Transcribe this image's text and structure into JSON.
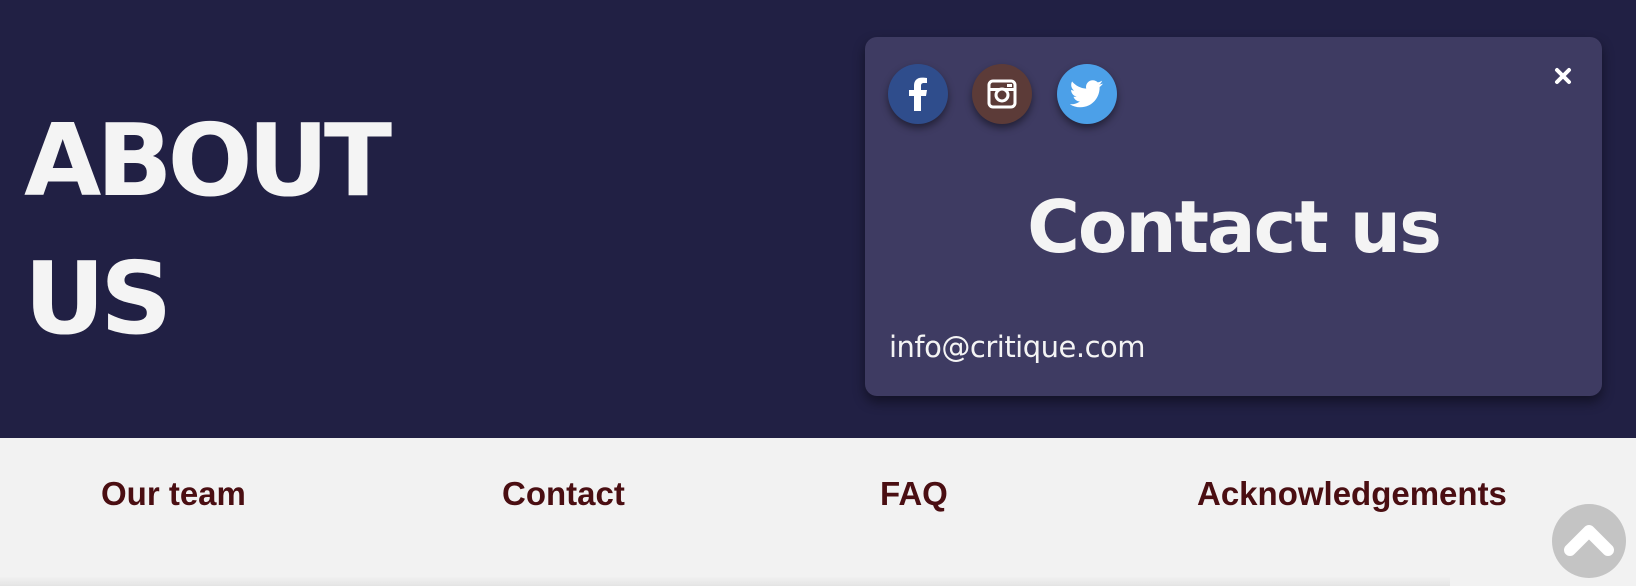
{
  "hero": {
    "title": "ABOUT US",
    "background": "#212044"
  },
  "contact_card": {
    "heading": "Contact us",
    "email": "info@critique.com",
    "background": "#3e3b62",
    "social": [
      {
        "name": "facebook",
        "icon": "facebook-icon",
        "color": "#2f4d8c"
      },
      {
        "name": "instagram",
        "icon": "instagram-icon",
        "color": "#5c3b38"
      },
      {
        "name": "twitter",
        "icon": "twitter-icon",
        "color": "#4ca0e8"
      }
    ],
    "close_icon": "close-icon"
  },
  "nav": {
    "items": [
      {
        "label": "Our team"
      },
      {
        "label": "Contact"
      },
      {
        "label": "FAQ"
      },
      {
        "label": "Acknowledgements"
      }
    ],
    "color": "#4a0e12"
  },
  "scroll_top": {
    "icon": "chevron-up-icon",
    "color": "#c4c4c4"
  }
}
